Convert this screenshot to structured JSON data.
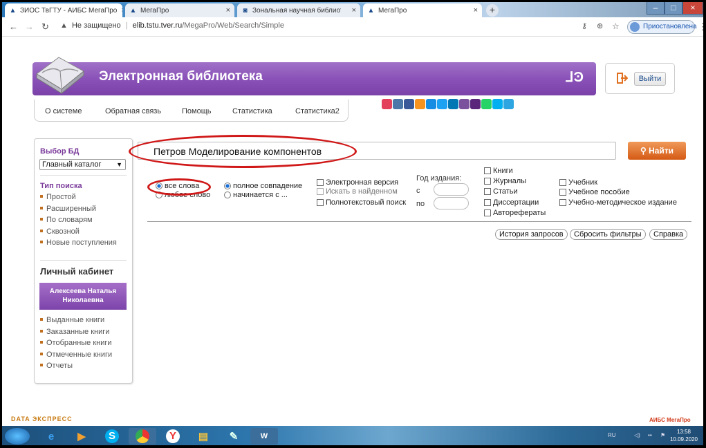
{
  "browser": {
    "tabs": [
      {
        "title": "ЗИОС ТвГТУ - АИБС МегаПро",
        "icon": "megapro-icon"
      },
      {
        "title": "МегаПро",
        "icon": "megapro-icon"
      },
      {
        "title": "Зональная научная библиотека",
        "icon": "library-icon"
      },
      {
        "title": "МегаПро",
        "icon": "megapro-icon"
      }
    ],
    "new_tab": "+",
    "url_warning": "Не защищено",
    "url_host": "elib.tstu.tver.ru",
    "url_path": "/MegaPro/Web/Search/Simple",
    "profile_label": "Приостановлена"
  },
  "header": {
    "title": "Электронная библиотека",
    "logout_label": "Выйти"
  },
  "menu": [
    "О системе",
    "Обратная связь",
    "Помощь",
    "Статистика",
    "Статистика2"
  ],
  "social_colors": [
    "#e3405c",
    "#4a76a8",
    "#3b5998",
    "#f7931e",
    "#168de2",
    "#1da1f2",
    "#0077b5",
    "#7b519d",
    "#59267c",
    "#25d366",
    "#00aff0",
    "#2ca5e0"
  ],
  "sidebar": {
    "db_heading": "Выбор БД",
    "db_selected": "Главный каталог",
    "search_type_heading": "Тип поиска",
    "search_types": [
      "Простой",
      "Расширенный",
      "По словарям",
      "Сквозной",
      "Новые поступления"
    ],
    "cabinet_heading": "Личный кабинет",
    "user_name": "Алексеева Наталья Николаевна",
    "cabinet_links": [
      "Выданные книги",
      "Заказанные книги",
      "Отобранные книги",
      "Отмеченные книги",
      "Отчеты"
    ]
  },
  "search": {
    "query": "Петров  Моделирование компонентов",
    "button_label": "Найти"
  },
  "options": {
    "all_words": "все слова",
    "any_word": "любое слово",
    "exact_match": "полное совпадение",
    "starts_with": "начинается с ...",
    "electronic": "Электронная версия",
    "in_found": "Искать в найденном",
    "fulltext": "Полнотекстовый поиск",
    "year_label": "Год издания:",
    "year_from": "с",
    "year_to": "по",
    "types_col1": [
      "Книги",
      "Журналы",
      "Статьи",
      "Диссертации",
      "Авторефераты"
    ],
    "types_col2": [
      "Учебник",
      "Учебное пособие",
      "Учебно-методическое издание"
    ]
  },
  "actions": {
    "history": "История запросов",
    "reset": "Сбросить фильтры",
    "help": "Справка"
  },
  "footer": {
    "left": "DATA ЭКСПРЕСС",
    "right": "АИБС МегаПро"
  },
  "taskbar": {
    "lang": "RU",
    "time": "13:58",
    "date": "10.09.2020"
  }
}
